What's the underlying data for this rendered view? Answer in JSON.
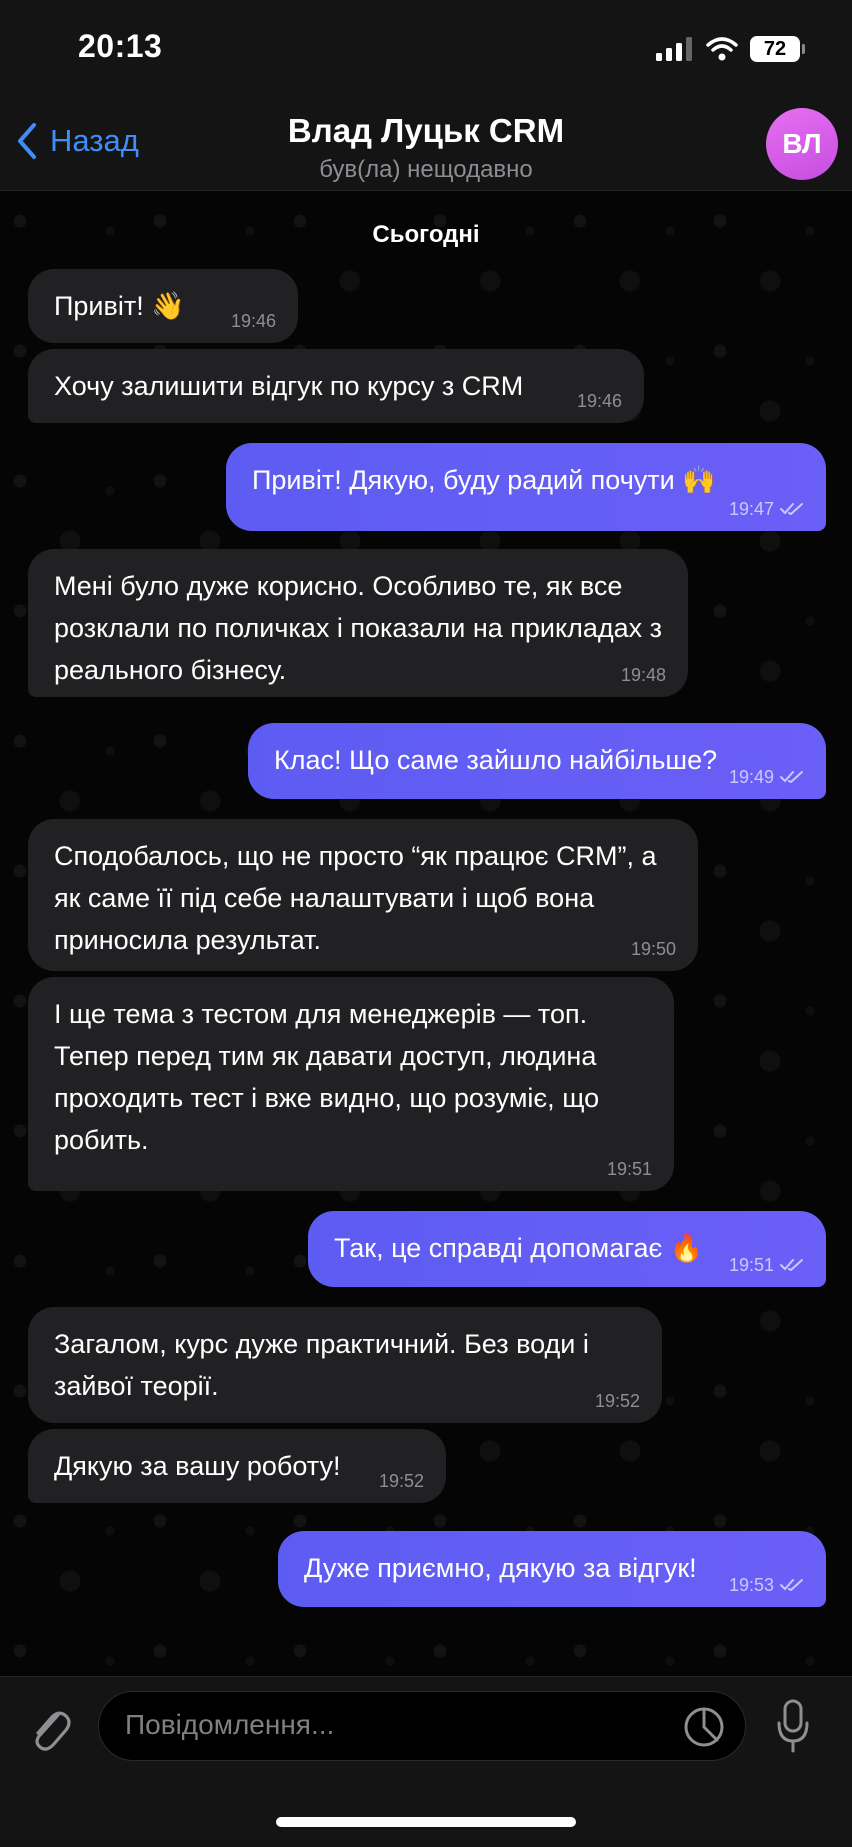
{
  "status": {
    "time": "20:13",
    "battery": "72"
  },
  "header": {
    "back_label": "Назад",
    "title": "Влад Луцьк CRM",
    "subtitle": "був(ла) нещодавно",
    "avatar_initials": "ВЛ"
  },
  "chat": {
    "day": "Сьогодні",
    "messages": [
      {
        "dir": "in",
        "text": "Привіт! 👋",
        "time": "19:46"
      },
      {
        "dir": "in",
        "text": "Хочу залишити відгук по курсу з CRM",
        "time": "19:46"
      },
      {
        "dir": "out",
        "text": "Привіт! Дякую, буду радий почути 🙌",
        "time": "19:47",
        "read": true
      },
      {
        "dir": "in",
        "text": "Мені було дуже корисно. Особливо те, як все розклали по поличках і показали на прикладах з реального бізнесу.",
        "time": "19:48"
      },
      {
        "dir": "out",
        "text": "Клас! Що саме зайшло найбільше?",
        "time": "19:49",
        "read": true
      },
      {
        "dir": "in",
        "text": "Сподобалось, що не просто “як працює CRM”, а як саме її під себе налаштувати і щоб вона приносила результат.",
        "time": "19:50"
      },
      {
        "dir": "in",
        "text": "І ще тема з тестом для менеджерів — топ. Тепер перед тим як давати доступ, людина проходить тест і вже видно, що розуміє, що робить.",
        "time": "19:51"
      },
      {
        "dir": "out",
        "text": "Так, це справді допомагає 🔥",
        "time": "19:51",
        "read": true
      },
      {
        "dir": "in",
        "text": "Загалом, курс дуже практичний. Без води і зайвої теорії.",
        "time": "19:52"
      },
      {
        "dir": "in",
        "text": "Дякую за вашу роботу!",
        "time": "19:52"
      },
      {
        "dir": "out",
        "text": "Дуже приємно, дякую за відгук!",
        "time": "19:53",
        "read": true
      }
    ]
  },
  "composer": {
    "placeholder": "Повідомлення..."
  }
}
